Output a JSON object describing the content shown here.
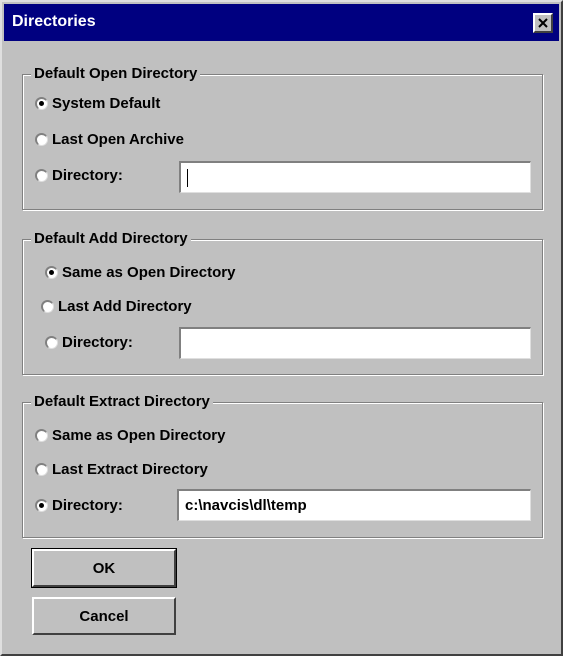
{
  "window": {
    "title": "Directories",
    "close_glyph": "✕"
  },
  "open_group": {
    "legend": "Default Open Directory",
    "options": [
      "System Default",
      "Last Open Archive",
      "Directory:"
    ],
    "selected_index": 0,
    "directory_value": ""
  },
  "add_group": {
    "legend": "Default Add Directory",
    "options": [
      "Same as Open Directory",
      "Last Add Directory",
      "Directory:"
    ],
    "selected_index": 0,
    "directory_value": ""
  },
  "extract_group": {
    "legend": "Default Extract Directory",
    "options": [
      "Same as Open Directory",
      "Last Extract Directory",
      "Directory:"
    ],
    "selected_index": 2,
    "directory_value": "c:\\navcis\\dl\\temp"
  },
  "buttons": {
    "ok_label": "OK",
    "cancel_label": "Cancel"
  },
  "colors": {
    "titlebar": "#000080",
    "face": "#c0c0c0"
  }
}
